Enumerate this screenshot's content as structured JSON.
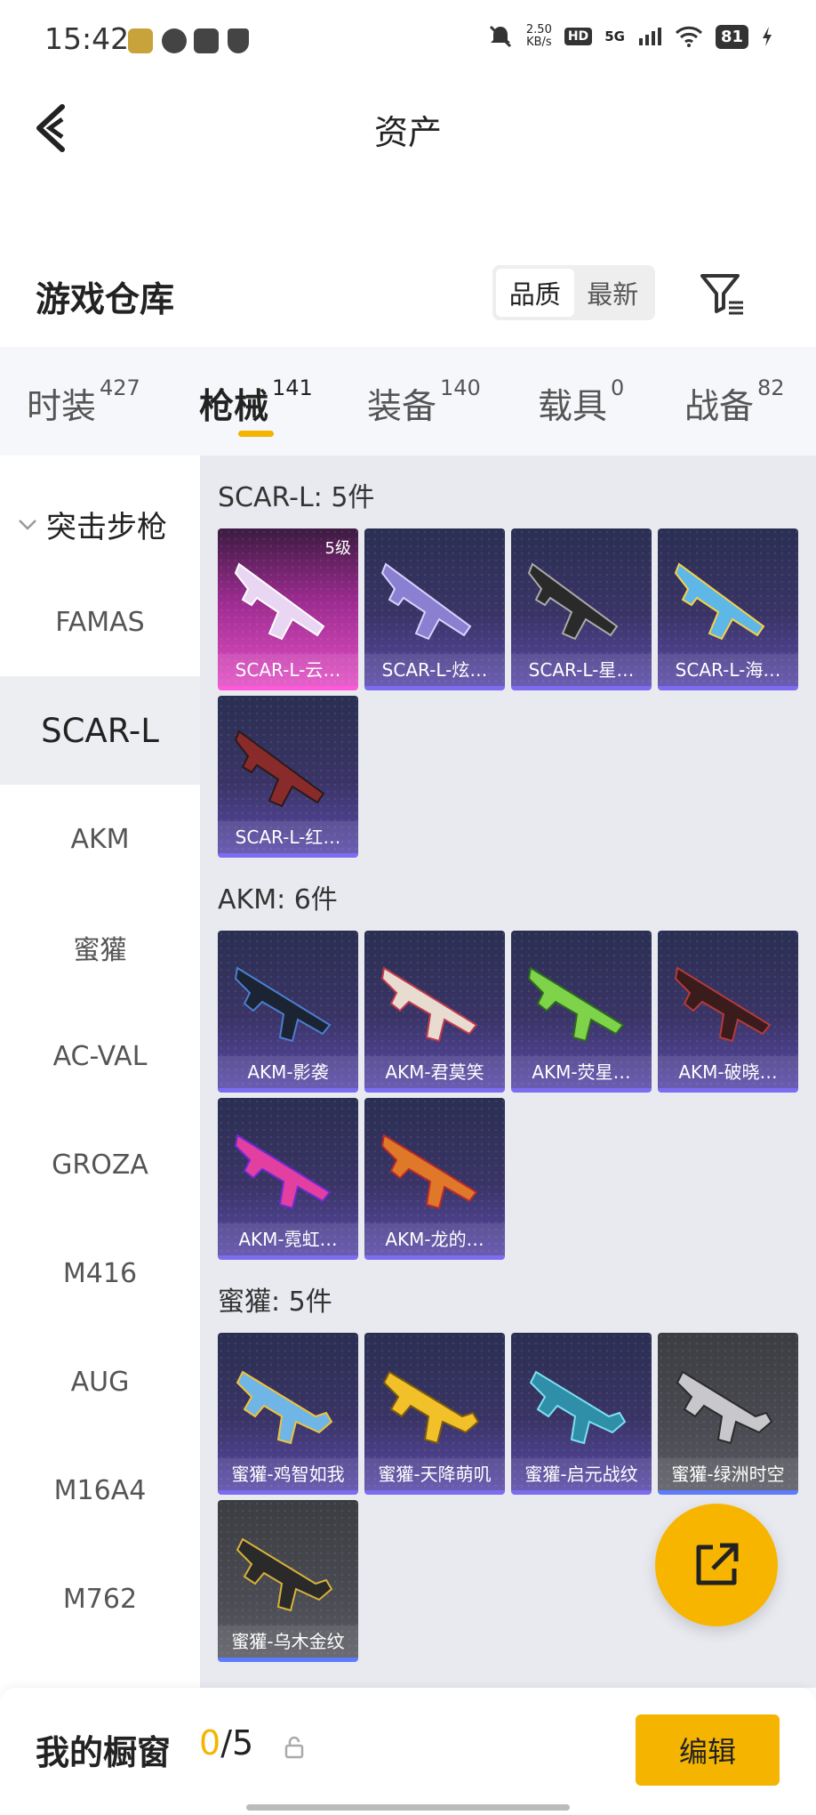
{
  "status_bar": {
    "time": "15:42",
    "net_speed_value": "2.50",
    "net_speed_unit": "KB/s",
    "hd": "HD",
    "network": "5G",
    "battery": "81"
  },
  "header": {
    "title": "资产"
  },
  "warehouse": {
    "title": "游戏仓库",
    "sort_quality": "品质",
    "sort_newest": "最新"
  },
  "tabs": [
    {
      "label": "时装",
      "count": "427"
    },
    {
      "label": "枪械",
      "count": "141"
    },
    {
      "label": "装备",
      "count": "140"
    },
    {
      "label": "载具",
      "count": "0"
    },
    {
      "label": "战备",
      "count": "82"
    }
  ],
  "sidebar": {
    "category": "突击步枪",
    "items": [
      "FAMAS",
      "SCAR-L",
      "AKM",
      "蜜獾",
      "AC-VAL",
      "GROZA",
      "M416",
      "AUG",
      "M16A4",
      "M762"
    ]
  },
  "groups": [
    {
      "title": "SCAR-L: 5件",
      "items": [
        {
          "name": "SCAR-L-云…",
          "level": "5级"
        },
        {
          "name": "SCAR-L-炫…"
        },
        {
          "name": "SCAR-L-星…"
        },
        {
          "name": "SCAR-L-海…"
        },
        {
          "name": "SCAR-L-红…"
        }
      ]
    },
    {
      "title": "AKM: 6件",
      "items": [
        {
          "name": "AKM-影袭"
        },
        {
          "name": "AKM-君莫笑"
        },
        {
          "name": "AKM-荧星…"
        },
        {
          "name": "AKM-破晓…"
        },
        {
          "name": "AKM-霓虹…"
        },
        {
          "name": "AKM-龙的…"
        }
      ]
    },
    {
      "title": "蜜獾: 5件",
      "items": [
        {
          "name": "蜜獾-鸡智如我"
        },
        {
          "name": "蜜獾-天降萌叽"
        },
        {
          "name": "蜜獾-启元战纹"
        },
        {
          "name": "蜜獾-绿洲时空"
        },
        {
          "name": "蜜獾-乌木金纹"
        }
      ]
    }
  ],
  "bottom_bar": {
    "label": "我的橱窗",
    "current": "0",
    "total": "/5",
    "edit": "编辑"
  },
  "colors": {
    "accent": "#f5b400",
    "card_purple": "#3a3466",
    "card_pink": "#e24ec4",
    "card_gray": "#4a4b52"
  }
}
